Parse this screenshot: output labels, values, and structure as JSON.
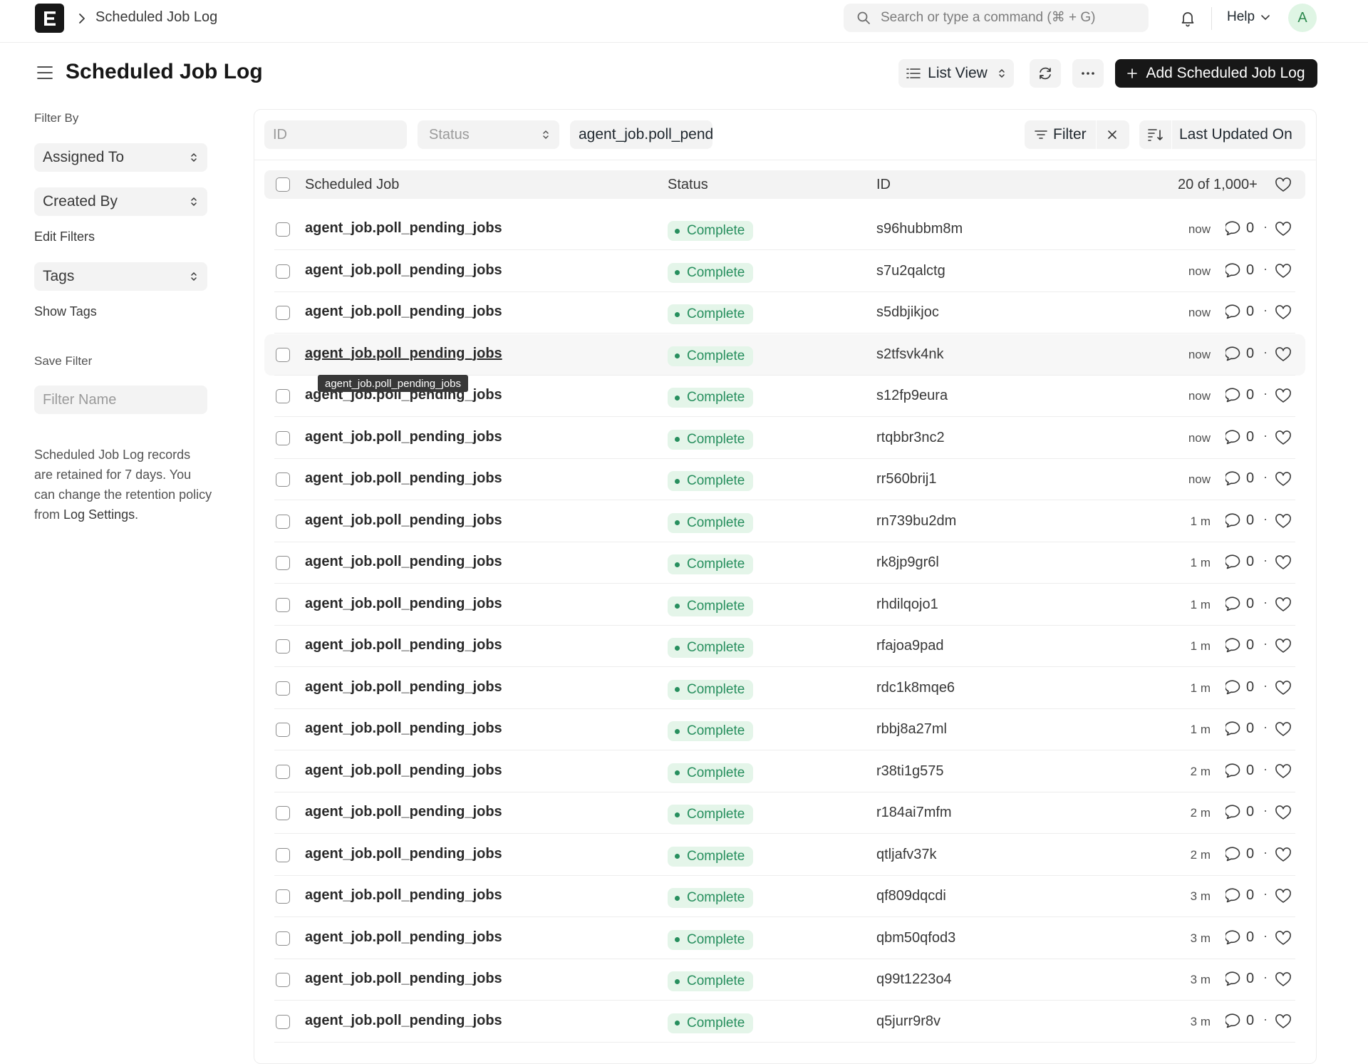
{
  "navbar": {
    "breadcrumb": "Scheduled Job Log",
    "search_placeholder": "Search or type a command (⌘ + G)",
    "help_label": "Help",
    "avatar_initial": "A"
  },
  "page": {
    "title": "Scheduled Job Log",
    "list_view_label": "List View",
    "add_button_label": "Add Scheduled Job Log"
  },
  "sidebar": {
    "filter_by_label": "Filter By",
    "assigned_to": "Assigned To",
    "created_by": "Created By",
    "edit_filters": "Edit Filters",
    "tags": "Tags",
    "show_tags": "Show Tags",
    "save_filter_label": "Save Filter",
    "filter_name_placeholder": "Filter Name",
    "note_text": "Scheduled Job Log records are retained for 7 days. You can change the retention policy from ",
    "note_link": "Log Settings",
    "note_end": "."
  },
  "filters": {
    "id_placeholder": "ID",
    "status_placeholder": "Status",
    "job_value": "agent_job.poll_pending_jobs",
    "filter_label": "Filter",
    "sort_label": "Last Updated On"
  },
  "table": {
    "headers": {
      "job": "Scheduled Job",
      "status": "Status",
      "id": "ID",
      "count": "20 of 1,000+"
    },
    "rows": [
      {
        "job": "agent_job.poll_pending_jobs",
        "status": "Complete",
        "id": "s96hubbm8m",
        "ago": "now",
        "comments": "0"
      },
      {
        "job": "agent_job.poll_pending_jobs",
        "status": "Complete",
        "id": "s7u2qalctg",
        "ago": "now",
        "comments": "0"
      },
      {
        "job": "agent_job.poll_pending_jobs",
        "status": "Complete",
        "id": "s5dbjikjoc",
        "ago": "now",
        "comments": "0"
      },
      {
        "job": "agent_job.poll_pending_jobs",
        "status": "Complete",
        "id": "s2tfsvk4nk",
        "ago": "now",
        "comments": "0"
      },
      {
        "job": "agent_job.poll_pending_jobs",
        "status": "Complete",
        "id": "s12fp9eura",
        "ago": "now",
        "comments": "0"
      },
      {
        "job": "agent_job.poll_pending_jobs",
        "status": "Complete",
        "id": "rtqbbr3nc2",
        "ago": "now",
        "comments": "0"
      },
      {
        "job": "agent_job.poll_pending_jobs",
        "status": "Complete",
        "id": "rr560brij1",
        "ago": "now",
        "comments": "0"
      },
      {
        "job": "agent_job.poll_pending_jobs",
        "status": "Complete",
        "id": "rn739bu2dm",
        "ago": "1 m",
        "comments": "0"
      },
      {
        "job": "agent_job.poll_pending_jobs",
        "status": "Complete",
        "id": "rk8jp9gr6l",
        "ago": "1 m",
        "comments": "0"
      },
      {
        "job": "agent_job.poll_pending_jobs",
        "status": "Complete",
        "id": "rhdilqojo1",
        "ago": "1 m",
        "comments": "0"
      },
      {
        "job": "agent_job.poll_pending_jobs",
        "status": "Complete",
        "id": "rfajoa9pad",
        "ago": "1 m",
        "comments": "0"
      },
      {
        "job": "agent_job.poll_pending_jobs",
        "status": "Complete",
        "id": "rdc1k8mqe6",
        "ago": "1 m",
        "comments": "0"
      },
      {
        "job": "agent_job.poll_pending_jobs",
        "status": "Complete",
        "id": "rbbj8a27ml",
        "ago": "1 m",
        "comments": "0"
      },
      {
        "job": "agent_job.poll_pending_jobs",
        "status": "Complete",
        "id": "r38ti1g575",
        "ago": "2 m",
        "comments": "0"
      },
      {
        "job": "agent_job.poll_pending_jobs",
        "status": "Complete",
        "id": "r184ai7mfm",
        "ago": "2 m",
        "comments": "0"
      },
      {
        "job": "agent_job.poll_pending_jobs",
        "status": "Complete",
        "id": "qtljafv37k",
        "ago": "2 m",
        "comments": "0"
      },
      {
        "job": "agent_job.poll_pending_jobs",
        "status": "Complete",
        "id": "qf809dqcdi",
        "ago": "3 m",
        "comments": "0"
      },
      {
        "job": "agent_job.poll_pending_jobs",
        "status": "Complete",
        "id": "qbm50qfod3",
        "ago": "3 m",
        "comments": "0"
      },
      {
        "job": "agent_job.poll_pending_jobs",
        "status": "Complete",
        "id": "q99t1223o4",
        "ago": "3 m",
        "comments": "0"
      },
      {
        "job": "agent_job.poll_pending_jobs",
        "status": "Complete",
        "id": "q5jurr9r8v",
        "ago": "3 m",
        "comments": "0"
      }
    ],
    "hovered_row_index": 3,
    "separator": "·"
  },
  "tooltip": "agent_job.poll_pending_jobs",
  "colors": {
    "status_complete_bg": "#e4f5e9",
    "status_complete_text": "#278f5e",
    "primary_button": "#171717"
  }
}
